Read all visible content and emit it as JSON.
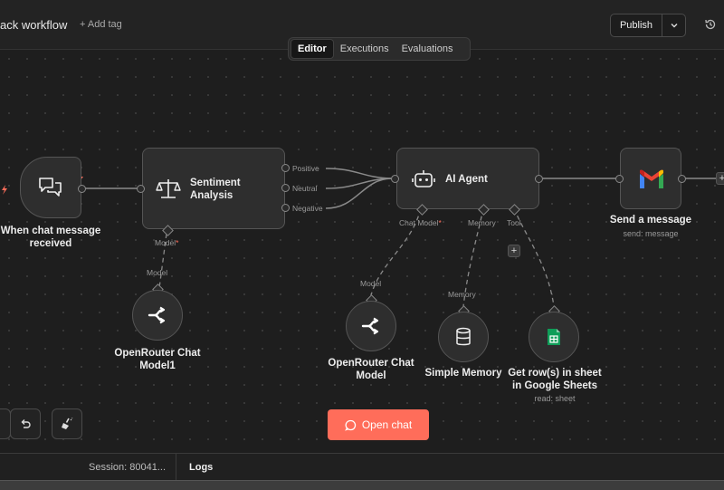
{
  "header": {
    "workflow_title": "ack workflow",
    "add_tag": "+ Add tag",
    "publish_label": "Publish"
  },
  "tabs": [
    {
      "label": "Editor",
      "active": true
    },
    {
      "label": "Executions",
      "active": false
    },
    {
      "label": "Evaluations",
      "active": false
    }
  ],
  "nodes": {
    "trigger": {
      "label_line1": "When chat message",
      "label_line2": "received",
      "icon": "chat-bubbles-icon"
    },
    "sentiment": {
      "label_line1": "Sentiment",
      "label_line2": "Analysis",
      "icon": "scales-icon",
      "outputs": [
        "Positive",
        "Neutral",
        "Negative"
      ],
      "model_port": "Model"
    },
    "agent": {
      "label": "AI Agent",
      "icon": "robot-icon",
      "ports": {
        "chat_model": "Chat Model",
        "memory": "Memory",
        "tool": "Tool"
      }
    },
    "gmail": {
      "label": "Send a message",
      "caption": "send: message",
      "icon": "gmail-icon"
    }
  },
  "sub_nodes": {
    "openrouter1": {
      "label_line1": "OpenRouter Chat",
      "label_line2": "Model1",
      "connector": "Model",
      "icon": "openrouter-icon"
    },
    "openrouter2": {
      "label_line1": "OpenRouter Chat",
      "label_line2": "Model",
      "connector": "Model",
      "icon": "openrouter-icon"
    },
    "memory": {
      "label": "Simple Memory",
      "connector": "Memory",
      "icon": "database-icon"
    },
    "sheets": {
      "label_line1": "Get row(s) in sheet",
      "label_line2": "in Google Sheets",
      "caption": "read: sheet",
      "icon": "google-sheets-icon"
    }
  },
  "canvas_controls": {
    "open_chat": "Open chat"
  },
  "bottombar": {
    "session": "Session: 80041...",
    "logs": "Logs"
  },
  "colors": {
    "accent": "#ff6d5a",
    "background": "#1e1e1e",
    "node": "#2e2e2e"
  }
}
